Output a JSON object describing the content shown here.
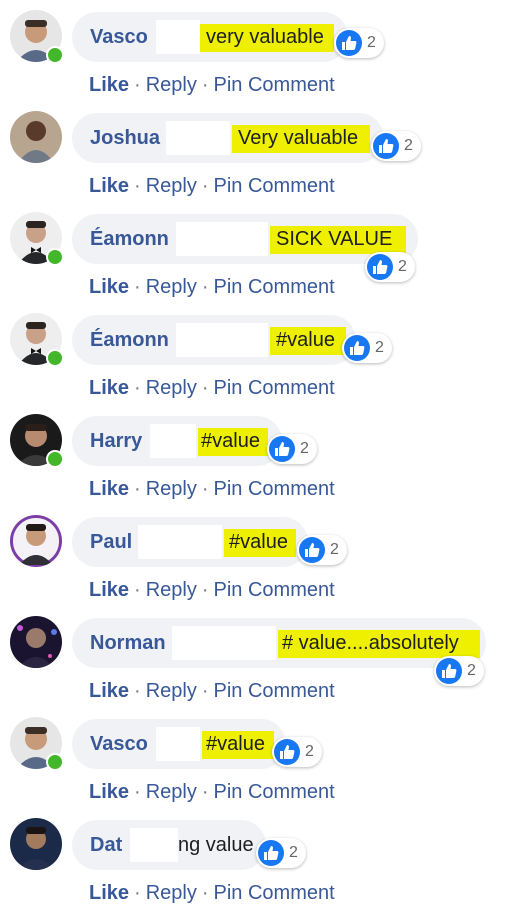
{
  "comments": [
    {
      "name": "Vasco",
      "text": "very valuable",
      "reactions": "2",
      "online": true,
      "avatar": "man-short-hair-beard-avatar",
      "actions": {
        "like": "Like",
        "reply": "Reply",
        "pin": "Pin Comment"
      }
    },
    {
      "name": "Joshua",
      "text": "Very valuable",
      "reactions": "2",
      "online": false,
      "avatar": "man-grey-suit-avatar",
      "actions": {
        "like": "Like",
        "reply": "Reply",
        "pin": "Pin Comment"
      }
    },
    {
      "name": "Éamonn",
      "text": "SICK VALUE",
      "reactions": "2",
      "online": true,
      "avatar": "man-bow-tie-avatar",
      "actions": {
        "like": "Like",
        "reply": "Reply",
        "pin": "Pin Comment"
      }
    },
    {
      "name": "Éamonn",
      "text": "#value",
      "reactions": "2",
      "online": true,
      "avatar": "man-bow-tie-avatar",
      "actions": {
        "like": "Like",
        "reply": "Reply",
        "pin": "Pin Comment"
      }
    },
    {
      "name": "Harry",
      "text": "#value",
      "reactions": "2",
      "online": true,
      "avatar": "man-dark-background-avatar",
      "actions": {
        "like": "Like",
        "reply": "Reply",
        "pin": "Pin Comment"
      }
    },
    {
      "name": "Paul",
      "text": "#value",
      "reactions": "2",
      "online": false,
      "avatar": "man-purple-ring-avatar",
      "actions": {
        "like": "Like",
        "reply": "Reply",
        "pin": "Pin Comment"
      }
    },
    {
      "name": "Norman",
      "text": "# value....absolutely",
      "reactions": "2",
      "online": false,
      "avatar": "man-neon-lights-avatar",
      "actions": {
        "like": "Like",
        "reply": "Reply",
        "pin": "Pin Comment"
      }
    },
    {
      "name": "Vasco",
      "text": "#value",
      "reactions": "2",
      "online": true,
      "avatar": "man-short-hair-beard-avatar",
      "actions": {
        "like": "Like",
        "reply": "Reply",
        "pin": "Pin Comment"
      }
    },
    {
      "name": "Dat",
      "text": "ng value",
      "reactions": "2",
      "online": false,
      "avatar": "man-navy-suit-avatar",
      "actions": {
        "like": "Like",
        "reply": "Reply",
        "pin": "Pin Comment"
      }
    }
  ],
  "colors": {
    "name": "#385898",
    "highlight": "#eef000",
    "bubble": "#f0f2f5",
    "like_blue": "#1877f2",
    "online": "#42b72a"
  }
}
